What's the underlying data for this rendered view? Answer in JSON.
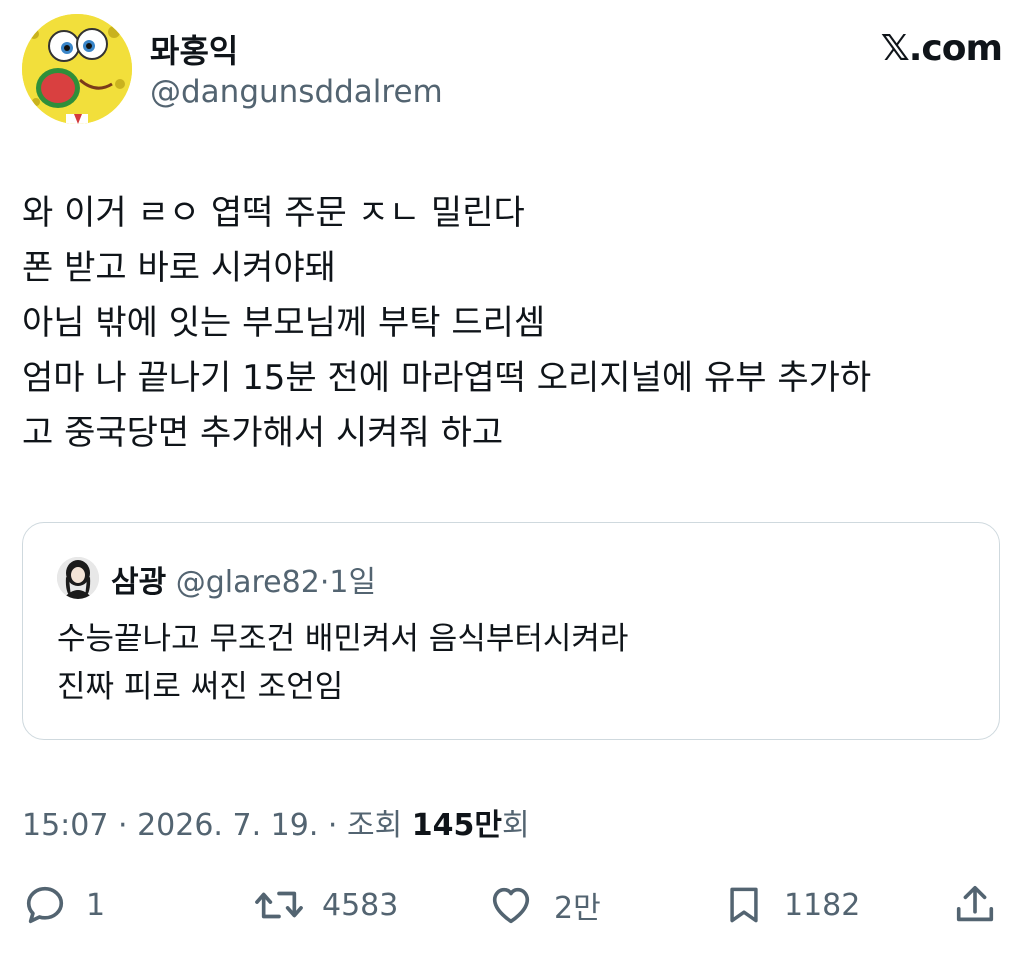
{
  "header": {
    "display_name": "뫄홍익",
    "handle": "@dangunsddalrem",
    "brand": "𝕏.com"
  },
  "tweet": {
    "lines": [
      "와 이거 ㄹㅇ 엽떡 주문 ㅈㄴ 밀린다",
      "폰 받고 바로 시켜야돼",
      "아님 밖에 잇는 부모님께 부탁 드리셈",
      "엄마 나 끝나기 15분 전에 마라엽떡 오리지널에 유부 추가하",
      "고 중국당면 추가해서 시켜줘 하고"
    ]
  },
  "quote": {
    "name": "삼광",
    "handle": "@glare82",
    "dot": "·",
    "time": "1일",
    "lines": [
      "수능끝나고 무조건 배민켜서 음식부터시켜라",
      "진짜 피로 써진 조언임"
    ]
  },
  "meta": {
    "time": "15:07",
    "sep1": " · ",
    "date": "2026. 7. 19.",
    "sep2": " · ",
    "views_label": "조회 ",
    "views_value": "145만",
    "views_suffix": "회"
  },
  "actions": {
    "reply": {
      "icon": "reply-icon",
      "count": "1"
    },
    "retweet": {
      "icon": "retweet-icon",
      "count": "4583"
    },
    "like": {
      "icon": "heart-icon",
      "count": "2만"
    },
    "bookmark": {
      "icon": "bookmark-icon",
      "count": "1182"
    },
    "share": {
      "icon": "share-icon"
    }
  },
  "colors": {
    "text": "#0f1419",
    "secondary": "#536471",
    "border": "#cfd9de"
  }
}
